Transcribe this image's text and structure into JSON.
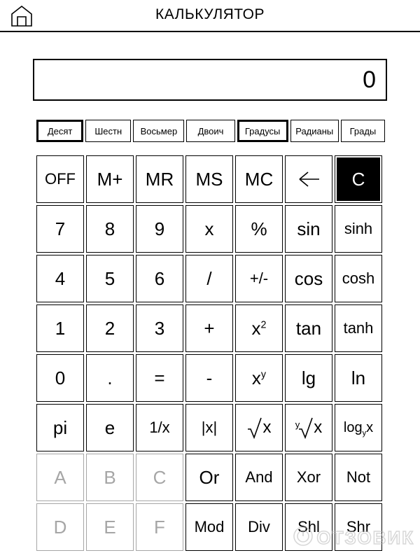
{
  "header": {
    "title": "КАЛЬКУЛЯТОР",
    "home_icon": "home-icon"
  },
  "display": {
    "value": "0"
  },
  "modes": {
    "number_base": [
      {
        "label": "Десят",
        "selected": true
      },
      {
        "label": "Шестн",
        "selected": false
      },
      {
        "label": "Восьмер",
        "selected": false
      },
      {
        "label": "Двоич",
        "selected": false
      }
    ],
    "angle_unit": [
      {
        "label": "Градусы",
        "selected": true
      },
      {
        "label": "Радианы",
        "selected": false
      },
      {
        "label": "Грады",
        "selected": false
      }
    ]
  },
  "keypad": {
    "rows": [
      [
        {
          "label": "OFF",
          "state": "normal",
          "size": "small"
        },
        {
          "label": "M+",
          "state": "normal",
          "size": "normal"
        },
        {
          "label": "MR",
          "state": "normal",
          "size": "normal"
        },
        {
          "label": "MS",
          "state": "normal",
          "size": "normal"
        },
        {
          "label": "MC",
          "state": "normal",
          "size": "normal"
        },
        {
          "label": "←",
          "state": "normal",
          "size": "icon"
        },
        {
          "label": "C",
          "state": "inverted",
          "size": "normal"
        }
      ],
      [
        {
          "label": "7",
          "state": "normal",
          "size": "normal"
        },
        {
          "label": "8",
          "state": "normal",
          "size": "normal"
        },
        {
          "label": "9",
          "state": "normal",
          "size": "normal"
        },
        {
          "label": "x",
          "state": "normal",
          "size": "normal"
        },
        {
          "label": "%",
          "state": "normal",
          "size": "normal"
        },
        {
          "label": "sin",
          "state": "normal",
          "size": "normal"
        },
        {
          "label": "sinh",
          "state": "normal",
          "size": "small"
        }
      ],
      [
        {
          "label": "4",
          "state": "normal",
          "size": "normal"
        },
        {
          "label": "5",
          "state": "normal",
          "size": "normal"
        },
        {
          "label": "6",
          "state": "normal",
          "size": "normal"
        },
        {
          "label": "/",
          "state": "normal",
          "size": "normal"
        },
        {
          "label": "+/-",
          "state": "normal",
          "size": "small"
        },
        {
          "label": "cos",
          "state": "normal",
          "size": "normal"
        },
        {
          "label": "cosh",
          "state": "normal",
          "size": "small"
        }
      ],
      [
        {
          "label": "1",
          "state": "normal",
          "size": "normal"
        },
        {
          "label": "2",
          "state": "normal",
          "size": "normal"
        },
        {
          "label": "3",
          "state": "normal",
          "size": "normal"
        },
        {
          "label": "+",
          "state": "normal",
          "size": "normal"
        },
        {
          "label": "x²",
          "state": "normal",
          "size": "sup"
        },
        {
          "label": "tan",
          "state": "normal",
          "size": "normal"
        },
        {
          "label": "tanh",
          "state": "normal",
          "size": "small"
        }
      ],
      [
        {
          "label": "0",
          "state": "normal",
          "size": "normal"
        },
        {
          "label": ".",
          "state": "normal",
          "size": "normal"
        },
        {
          "label": "=",
          "state": "normal",
          "size": "normal"
        },
        {
          "label": "-",
          "state": "normal",
          "size": "normal"
        },
        {
          "label": "xʸ",
          "state": "normal",
          "size": "sup"
        },
        {
          "label": "lg",
          "state": "normal",
          "size": "normal"
        },
        {
          "label": "ln",
          "state": "normal",
          "size": "normal"
        }
      ],
      [
        {
          "label": "pi",
          "state": "normal",
          "size": "normal"
        },
        {
          "label": "e",
          "state": "normal",
          "size": "normal"
        },
        {
          "label": "1/x",
          "state": "normal",
          "size": "small"
        },
        {
          "label": "|x|",
          "state": "normal",
          "size": "small"
        },
        {
          "label": "√x",
          "state": "normal",
          "size": "radical"
        },
        {
          "label": "ʸ√x",
          "state": "normal",
          "size": "radical-y"
        },
        {
          "label": "logᵧx",
          "state": "normal",
          "size": "logy"
        }
      ],
      [
        {
          "label": "A",
          "state": "disabled",
          "size": "normal"
        },
        {
          "label": "B",
          "state": "disabled",
          "size": "normal"
        },
        {
          "label": "C",
          "state": "disabled",
          "size": "normal"
        },
        {
          "label": "Or",
          "state": "normal",
          "size": "normal"
        },
        {
          "label": "And",
          "state": "normal",
          "size": "small"
        },
        {
          "label": "Xor",
          "state": "normal",
          "size": "small"
        },
        {
          "label": "Not",
          "state": "normal",
          "size": "small"
        }
      ],
      [
        {
          "label": "D",
          "state": "disabled",
          "size": "normal"
        },
        {
          "label": "E",
          "state": "disabled",
          "size": "normal"
        },
        {
          "label": "F",
          "state": "disabled",
          "size": "normal"
        },
        {
          "label": "Mod",
          "state": "normal",
          "size": "small"
        },
        {
          "label": "Div",
          "state": "normal",
          "size": "small"
        },
        {
          "label": "Shl",
          "state": "normal",
          "size": "small"
        },
        {
          "label": "Shr",
          "state": "normal",
          "size": "small"
        }
      ]
    ]
  },
  "watermark": {
    "text": "ОТЗОВИК",
    "icon": "power-circle-icon"
  },
  "colors": {
    "background": "#ffffff",
    "foreground": "#000000",
    "disabled": "#a6a6a6",
    "watermark": "#b8b8b8"
  }
}
